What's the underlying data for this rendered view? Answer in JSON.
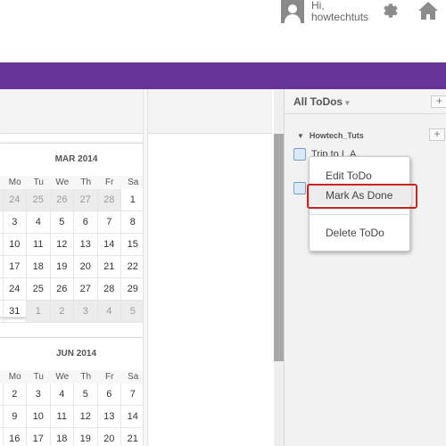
{
  "header": {
    "greeting": "Hi,",
    "username": "howtechtuts"
  },
  "calendar_top": {
    "title": "MAR 2014",
    "weekdays": [
      "Mo",
      "Tu",
      "We",
      "Th",
      "Fr",
      "Sa"
    ],
    "rows": [
      [
        "24",
        "25",
        "26",
        "27",
        "28",
        "1"
      ],
      [
        "3",
        "4",
        "5",
        "6",
        "7",
        "8"
      ],
      [
        "10",
        "11",
        "12",
        "13",
        "14",
        "15"
      ],
      [
        "17",
        "18",
        "19",
        "20",
        "21",
        "22"
      ],
      [
        "24",
        "25",
        "26",
        "27",
        "28",
        "29"
      ],
      [
        "31",
        "1",
        "2",
        "3",
        "4",
        "5"
      ]
    ]
  },
  "calendar_bottom": {
    "title": "JUN 2014",
    "weekdays": [
      "Mo",
      "Tu",
      "We",
      "Th",
      "Fr",
      "Sa"
    ],
    "rows": [
      [
        "2",
        "3",
        "4",
        "5",
        "6",
        "7"
      ],
      [
        "9",
        "10",
        "11",
        "12",
        "13",
        "14"
      ],
      [
        "16",
        "17",
        "18",
        "19",
        "20",
        "21"
      ]
    ]
  },
  "todos": {
    "filter_label": "All ToDos",
    "add_label": "+",
    "group_name": "Howtech_Tuts",
    "items": [
      "Trip to L.A."
    ]
  },
  "context_menu": {
    "edit": "Edit ToDo",
    "mark_done": "Mark As Done",
    "delete": "Delete ToDo"
  },
  "colors": {
    "accent": "#663399",
    "highlight": "#cc2222"
  }
}
